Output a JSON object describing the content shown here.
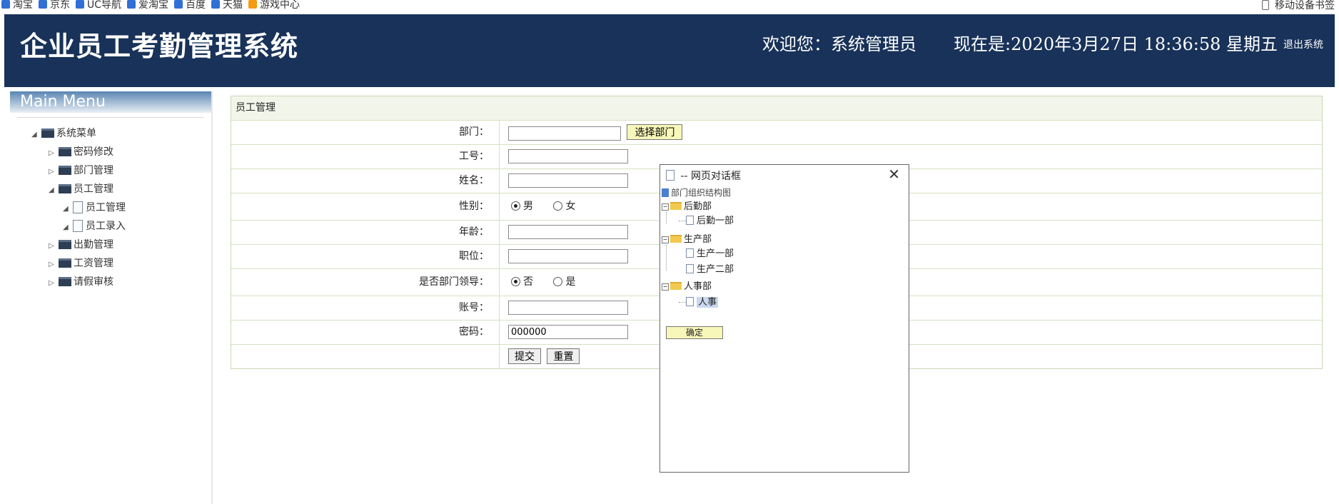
{
  "bookmarks": {
    "items": [
      "淘宝",
      "京东",
      "UC导航",
      "爱淘宝",
      "百度",
      "天猫",
      "游戏中心"
    ],
    "mobile": "移动设备书签"
  },
  "header": {
    "title": "企业员工考勤管理系统",
    "welcome": "欢迎您：系统管理员",
    "datetime": "现在是:2020年3月27日 18:36:58 星期五",
    "logout": "退出系统"
  },
  "sidebar": {
    "menu_title": "Main Menu",
    "root": "系统菜单",
    "items": {
      "pwd": "密码修改",
      "dept": "部门管理",
      "emp": "员工管理",
      "emp_manage": "员工管理",
      "emp_add": "员工录入",
      "attendance": "出勤管理",
      "salary": "工资管理",
      "leave": "请假审核"
    }
  },
  "form": {
    "title": "员工管理",
    "dept_label": "部门：",
    "select_dept_btn": "选择部门",
    "empno_label": "工号：",
    "name_label": "姓名：",
    "gender_label": "性别：",
    "male": "男",
    "female": "女",
    "age_label": "年龄：",
    "position_label": "职位：",
    "leader_label": "是否部门领导：",
    "no": "否",
    "yes": "是",
    "account_label": "账号：",
    "password_label": "密码：",
    "password_value": "000000",
    "submit": "提交",
    "reset": "重置"
  },
  "dialog": {
    "title": "-- 网页对话框",
    "tree_title": "部门组织结构图",
    "dept_logistics": "后勤部",
    "logistics_1": "后勤一部",
    "dept_production": "生产部",
    "production_1": "生产一部",
    "production_2": "生产二部",
    "dept_hr": "人事部",
    "hr_1": "人事",
    "ok": "确定"
  },
  "colors": {
    "header_bg": "#183259",
    "button_yellow": "#f6f7b9",
    "form_border": "#c9d8b5"
  }
}
